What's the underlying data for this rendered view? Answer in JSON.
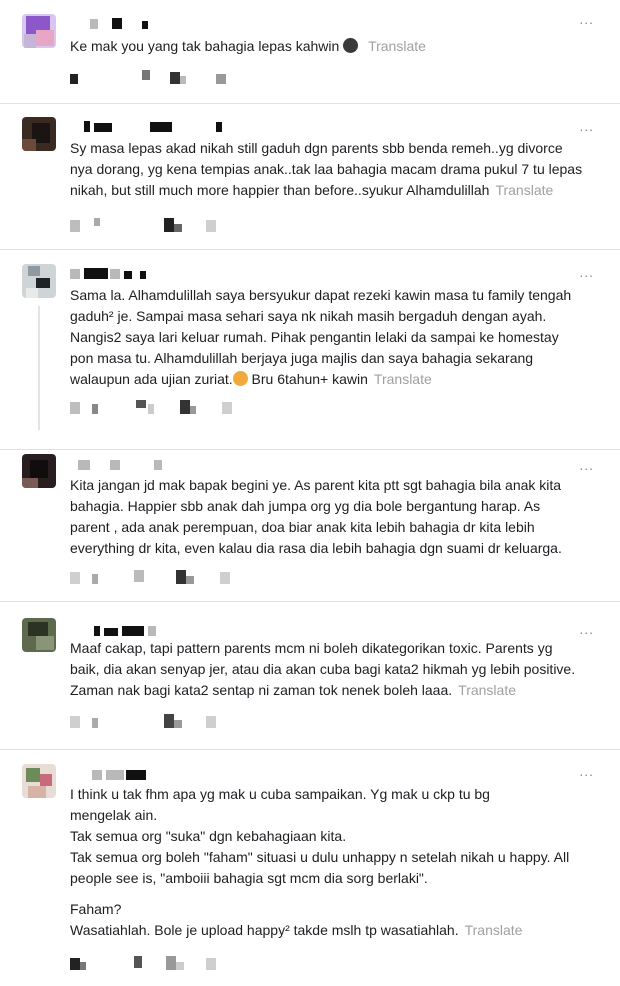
{
  "more_label": "...",
  "translate_label": "Translate",
  "comments": [
    {
      "lines": [
        "Ke mak you yang tak bahagia lepas kahwin"
      ],
      "emoji": "sad-face-icon"
    },
    {
      "lines": [
        "Sy masa lepas akad nikah still gaduh dgn parents sbb benda remeh..yg divorce",
        "nya dorang, yg kena tempias anak..tak laa bahagia macam drama pukul 7 tu lepas",
        "nikah, but still much more happier than before..syukur Alhamdulillah"
      ]
    },
    {
      "lines": [
        "Sama la. Alhamdulillah saya bersyukur dapat rezeki kawin masa tu family tengah",
        "gaduh² je. Sampai masa sehari saya nk nikah masih bergaduh dengan ayah.",
        "Nangis2 saya lari keluar rumah. Pihak pengantin lelaki da sampai ke homestay",
        "pon masa tu. Alhamdulillah berjaya juga majlis dan saya bahagia sekarang",
        "walaupun ada ujian zuriat.",
        " Bru 6tahun+ kawin"
      ],
      "emoji": "smiling-hearts-face-icon"
    },
    {
      "lines": [
        "Kita jangan jd mak bapak begini ye. As parent kita ptt sgt bahagia bila anak kita",
        "bahagia. Happier sbb anak dah jumpa org yg dia bole bergantung harap. As",
        "parent , ada anak perempuan, doa biar anak kita lebih bahagia dr kita lebih",
        "everything dr kita, even kalau dia rasa dia lebih bahagia dgn suami dr keluarga."
      ]
    },
    {
      "lines": [
        "Maaf cakap, tapi pattern parents mcm ni boleh dikategorikan toxic. Parents yg",
        "baik, dia akan senyap jer, atau dia akan cuba bagi kata2 hikmah yg lebih positive.",
        "Zaman nak bagi kata2 sentap ni zaman tok nenek boleh laaa."
      ]
    },
    {
      "lines": [
        "I think u tak fhm apa yg mak u cuba sampaikan. Yg mak u ckp tu bg",
        "mengelak ain.",
        "Tak semua org \"suka\" dgn kebahagiaan kita.",
        "Tak semua org boleh \"faham\" situasi u dulu unhappy n setelah nikah u happy. All",
        "people see is, \"amboiii bahagia sgt mcm dia sorg berlaki\".",
        "Faham?",
        "Wasatiahlah. Bole je upload happy² takde mslh tp wasatiahlah."
      ]
    }
  ]
}
